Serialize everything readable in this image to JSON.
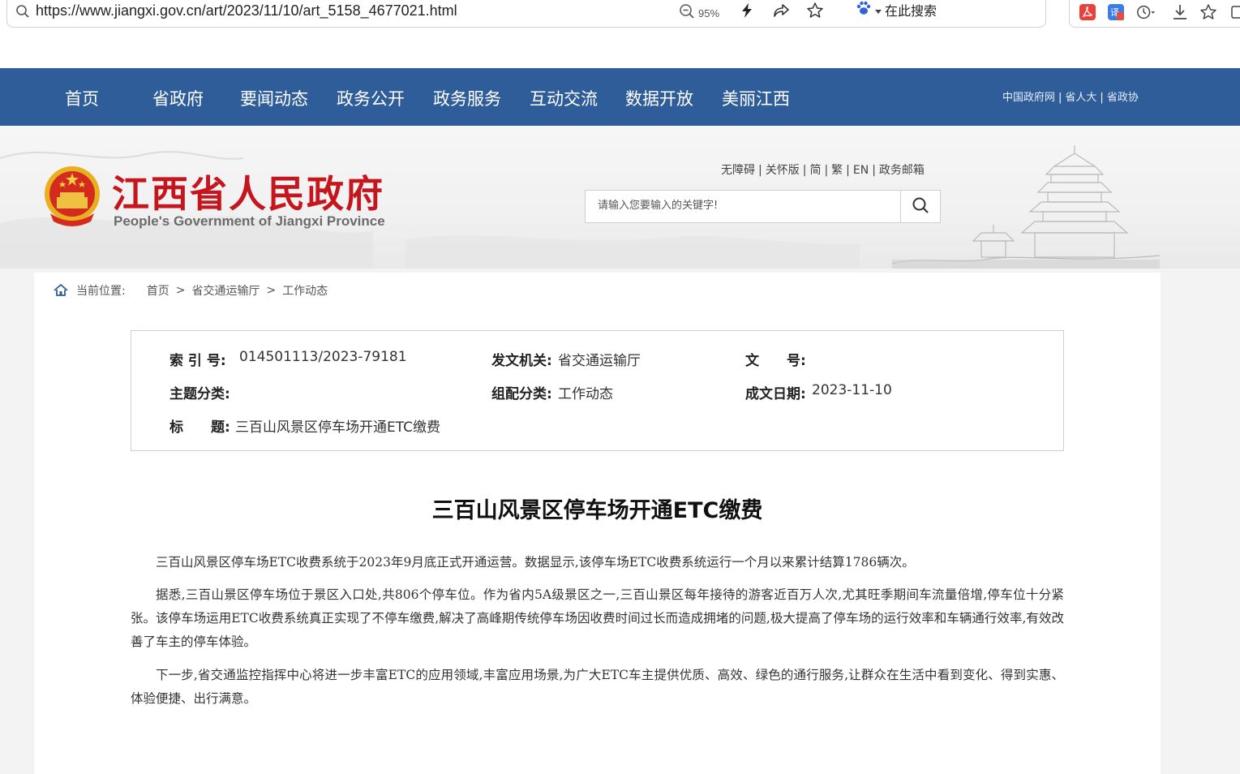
{
  "browser": {
    "url": "https://www.jiangxi.gov.cn/art/2023/11/10/art_5158_4677021.html",
    "zoom": "95%",
    "search_engine_label": "在此搜索"
  },
  "nav": {
    "items": [
      "首页",
      "省政府",
      "要闻动态",
      "政务公开",
      "政务服务",
      "互动交流",
      "数据开放",
      "美丽江西"
    ],
    "external_links": [
      "中国政府网",
      "省人大",
      "省政协"
    ]
  },
  "header": {
    "site_title": "江西省人民政府",
    "site_subtitle": "People's Government of Jiangxi Province",
    "util_links": [
      "无障碍",
      "关怀版",
      "简",
      "繁",
      "EN",
      "政务邮箱"
    ],
    "search_placeholder": "请输入您要输入的关键字!"
  },
  "breadcrumb": {
    "label": "当前位置:",
    "items": [
      "首页",
      "省交通运输厅",
      "工作动态"
    ]
  },
  "meta": {
    "index_label": "索 引 号:",
    "index_value": "014501113/2023-79181",
    "issuer_label": "发文机关:",
    "issuer_value": "省交通运输厅",
    "doc_no_label": "文　　号:",
    "doc_no_value": "",
    "topic_label": "主题分类:",
    "topic_value": "",
    "category_label": "组配分类:",
    "category_value": "工作动态",
    "date_label": "成文日期:",
    "date_value": "2023-11-10",
    "title_label": "标　　题:",
    "title_value": "三百山风景区停车场开通ETC缴费"
  },
  "article": {
    "title": "三百山风景区停车场开通ETC缴费",
    "paragraphs": [
      "三百山风景区停车场ETC收费系统于2023年9月底正式开通运营。数据显示,该停车场ETC收费系统运行一个月以来累计结算1786辆次。",
      "据悉,三百山景区停车场位于景区入口处,共806个停车位。作为省内5A级景区之一,三百山景区每年接待的游客近百万人次,尤其旺季期间车流量倍增,停车位十分紧张。该停车场运用ETC收费系统真正实现了不停车缴费,解决了高峰期传统停车场因收费时间过长而造成拥堵的问题,极大提高了停车场的运行效率和车辆通行效率,有效改善了车主的停车体验。",
      "下一步,省交通监控指挥中心将进一步丰富ETC的应用领域,丰富应用场景,为广大ETC车主提供优质、高效、绿色的通行服务,让群众在生活中看到变化、得到实惠、体验便捷、出行满意。"
    ]
  },
  "colors": {
    "nav_bg": "#2f5d99",
    "title_red": "#c4161c",
    "page_bg": "#f3f3f3"
  },
  "icons": [
    "search-icon",
    "zoom-icon",
    "lightning-icon",
    "share-icon",
    "favorite-star-icon",
    "paw-icon",
    "pdf-icon",
    "translate-icon",
    "history-icon",
    "download-icon",
    "collections-icon",
    "home-icon",
    "emblem-icon"
  ]
}
